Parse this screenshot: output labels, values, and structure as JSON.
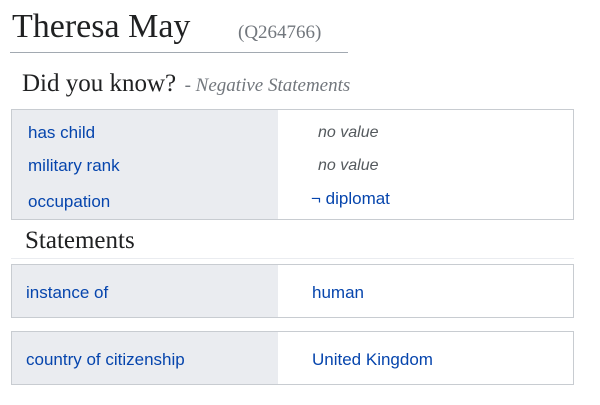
{
  "header": {
    "title": "Theresa May",
    "qid": "(Q264766)"
  },
  "did_you_know": {
    "title": "Did you know?",
    "subtitle": "- Negative Statements",
    "rows": [
      {
        "property": "has child",
        "value": "no value"
      },
      {
        "property": "military rank",
        "value": "no value"
      },
      {
        "property": "occupation",
        "value": "¬ diplomat"
      }
    ]
  },
  "statements": {
    "title": "Statements",
    "rows": [
      {
        "property": "instance of",
        "value": "human"
      },
      {
        "property": "country of citizenship",
        "value": "United Kingdom"
      }
    ]
  },
  "colors": {
    "link": "#0645ad",
    "label_bg": "#eaecf0",
    "border": "#c8ccd1",
    "muted": "#72777d"
  }
}
